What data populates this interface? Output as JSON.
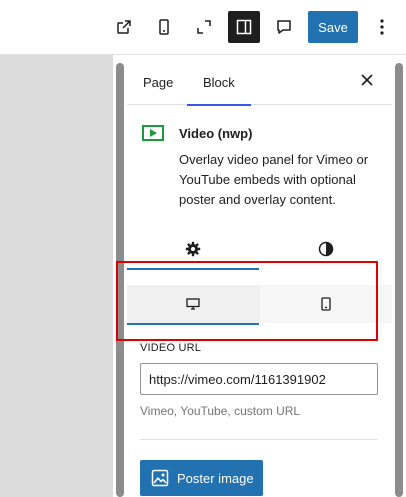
{
  "toolbar": {
    "icons": [
      "external-link-icon",
      "mobile-preview-icon",
      "fullscreen-icon",
      "sidebar-toggle-icon",
      "comment-icon",
      "more-vertical-icon"
    ],
    "save_label": "Save"
  },
  "sidebar": {
    "tabs": [
      {
        "label": "Page",
        "active": false
      },
      {
        "label": "Block",
        "active": true
      }
    ],
    "close_icon": "close-icon",
    "block": {
      "icon": "video-icon",
      "title": "Video (nwp)",
      "description": "Overlay video panel for Vimeo or YouTube embeds with optional poster and overlay content."
    },
    "style_tabs": [
      {
        "icon": "gear-icon",
        "active": true
      },
      {
        "icon": "contrast-icon",
        "active": false
      }
    ],
    "device_tabs": [
      {
        "icon": "desktop-icon",
        "active": true
      },
      {
        "icon": "mobile-icon",
        "active": false
      }
    ],
    "video_url": {
      "label": "VIDEO URL",
      "value": "https://vimeo.com/1161391902",
      "help": "Vimeo, YouTube, custom URL"
    },
    "poster_button": {
      "icon": "image-icon",
      "label": "Poster image"
    }
  },
  "colors": {
    "accent": "#2271b1",
    "tab_underline": "#3858e9",
    "highlight_box": "#e00000",
    "block_icon": "#1a9c3e"
  }
}
